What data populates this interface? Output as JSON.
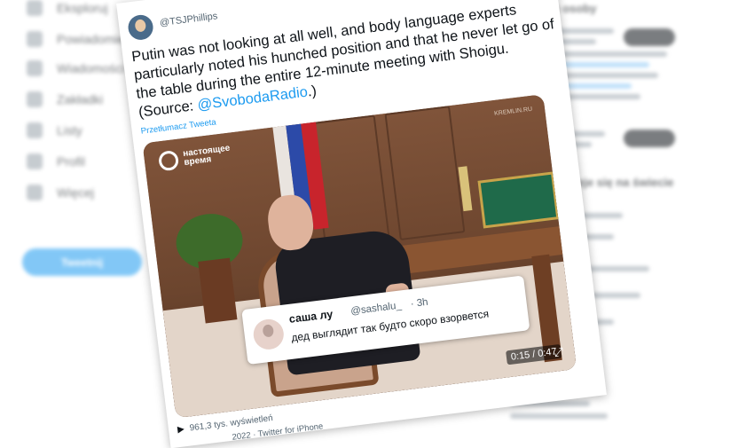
{
  "background": {
    "nav_items": [
      {
        "label": "Eksploruj",
        "icon": "hashtag-icon"
      },
      {
        "label": "Powiadomienia",
        "icon": "bell-icon"
      },
      {
        "label": "Wiadomości",
        "icon": "mail-icon"
      },
      {
        "label": "Zakładki",
        "icon": "bookmark-icon"
      },
      {
        "label": "Listy",
        "icon": "list-icon"
      },
      {
        "label": "Profil",
        "icon": "person-icon"
      },
      {
        "label": "Więcej",
        "icon": "more-icon"
      }
    ],
    "nav_button": "Tweetnij",
    "right_title_1": "Podobne osoby",
    "right_title_2": "Co dzieje się na świecie"
  },
  "tweet": {
    "handle": "@TSJPhillips",
    "text_main": "Putin was not looking at all well, and body language experts particularly noted his hunched position and that he never let go of the table during the entire 12-minute meeting with Shoigu. (Source: ",
    "mention": "@SvobodaRadio",
    "text_end": ".)",
    "translate": "Przetłumacz Tweeta",
    "views": "961,3 tys. wyświetleń",
    "footer_date": "2022",
    "footer_source": "Twitter for iPhone"
  },
  "video": {
    "logo_text": "настоящее время",
    "watermark": "KREMLIN.RU",
    "timer": "0:15 / 0:47",
    "reply": {
      "name": "саша лу",
      "handle": "@sashalu_",
      "time": "· 3h",
      "text": "дед выглядит так будто скоро взорвется"
    }
  },
  "colors": {
    "accent": "#1d9bf0",
    "text": "#0f1419",
    "muted": "#536471"
  }
}
